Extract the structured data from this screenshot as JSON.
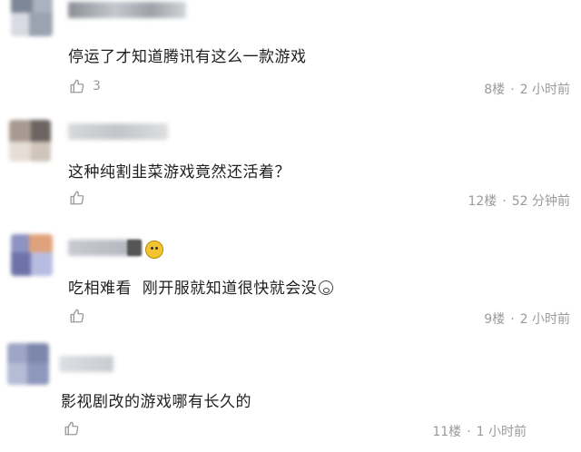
{
  "comments": [
    {
      "text": "停运了才知道腾讯有这么一款游戏",
      "likes": "3",
      "floor": "8楼",
      "time": "2 小时前",
      "has_badge": false
    },
    {
      "text": "这种纯割韭菜游戏竟然还活着？",
      "likes": "",
      "floor": "12楼",
      "time": "52 分钟前",
      "has_badge": false
    },
    {
      "text": "吃相难看  刚开服就知道很快就会没",
      "likes": "",
      "floor": "9楼",
      "time": "2 小时前",
      "has_badge": true
    },
    {
      "text": "影视剧改的游戏哪有长久的",
      "likes": "",
      "floor": "11楼",
      "time": "1 小时前",
      "has_badge": false
    }
  ],
  "meta_separator": "·",
  "icons": {
    "like": "thumbs-up-icon",
    "badge": "emoji-badge-icon",
    "emoji": "surprised-face-icon"
  },
  "colors": {
    "text": "#1f1f1f",
    "meta": "#9a9a9a"
  }
}
